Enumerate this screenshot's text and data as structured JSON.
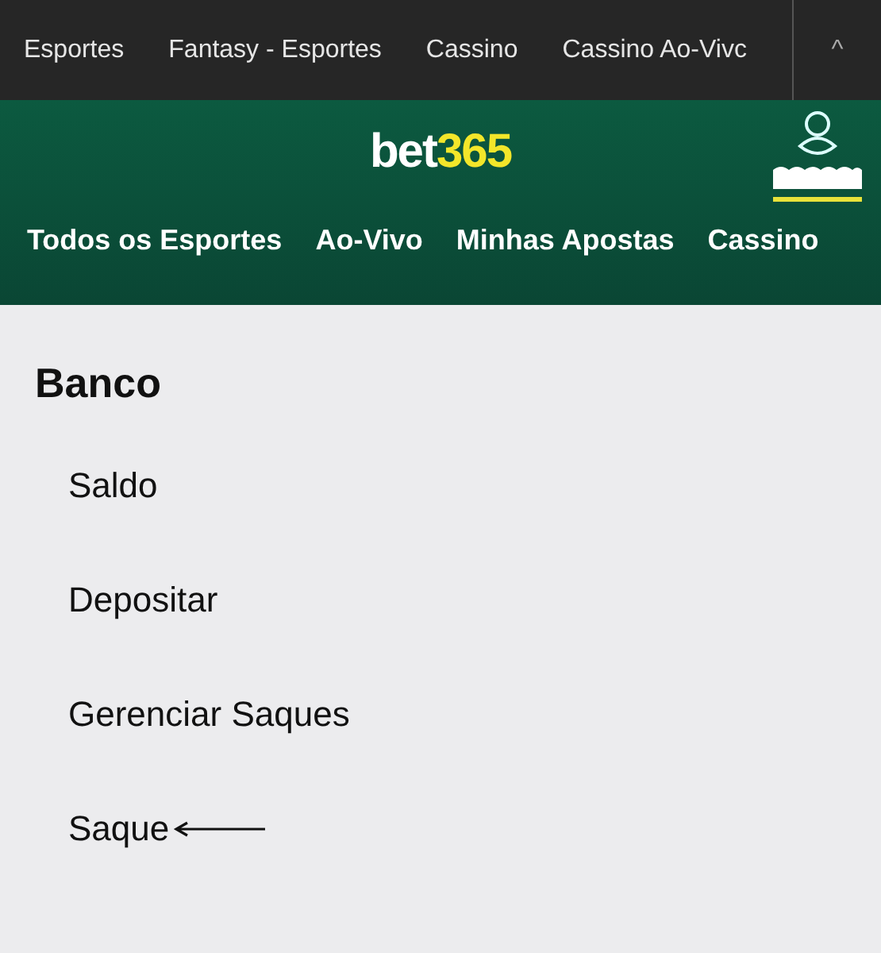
{
  "top_nav": {
    "items": [
      {
        "label": "Esportes"
      },
      {
        "label": "Fantasy - Esportes"
      },
      {
        "label": "Cassino"
      },
      {
        "label": "Cassino Ao-Vivc"
      }
    ],
    "collapse_icon": "^"
  },
  "header": {
    "logo": {
      "part_1": "bet",
      "part_2": "365"
    },
    "menu": [
      {
        "label": "Todos os Esportes"
      },
      {
        "label": "Ao-Vivo"
      },
      {
        "label": "Minhas Apostas"
      },
      {
        "label": "Cassino"
      }
    ]
  },
  "section": {
    "title": "Banco",
    "items": [
      {
        "label": "Saldo",
        "marked": false
      },
      {
        "label": "Depositar",
        "marked": false
      },
      {
        "label": "Gerenciar Saques",
        "marked": false
      },
      {
        "label": "Saque",
        "marked": true
      }
    ]
  }
}
